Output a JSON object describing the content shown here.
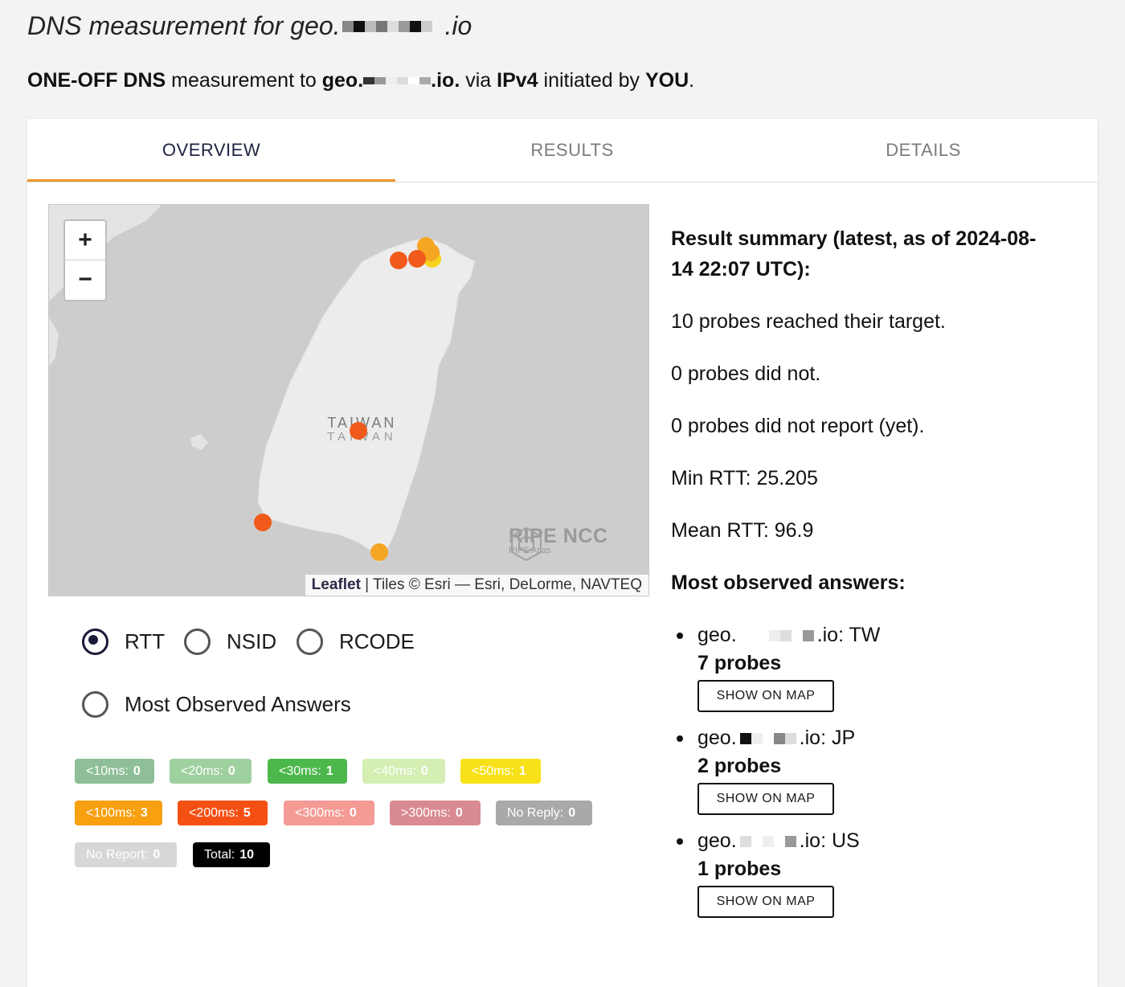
{
  "page": {
    "title_prefix": "DNS measurement for geo.",
    "title_suffix": ".io"
  },
  "subtitle": {
    "type": "ONE-OFF DNS",
    "text1": " measurement to ",
    "target_prefix": "geo.",
    "target_suffix": ".io.",
    "text2": " via ",
    "protocol": "IPv4",
    "text3": " initiated by ",
    "initiator": "YOU",
    "text4": "."
  },
  "tabs": [
    {
      "label": "OVERVIEW",
      "active": true
    },
    {
      "label": "RESULTS",
      "active": false
    },
    {
      "label": "DETAILS",
      "active": false
    }
  ],
  "map": {
    "zoom_in": "+",
    "zoom_out": "−",
    "country_label": "TAIWAN",
    "country_label_native": "TAIWAN",
    "logo_name": "RIPE NCC",
    "logo_sub": "RIPE Atlas",
    "attribution_link": "Leaflet",
    "attribution_text": " | Tiles © Esri — Esri, DeLorme, NAVTEQ"
  },
  "view_options": [
    {
      "label": "RTT",
      "checked": true
    },
    {
      "label": "NSID",
      "checked": false
    },
    {
      "label": "RCODE",
      "checked": false
    },
    {
      "label": "Most Observed Answers",
      "checked": false
    }
  ],
  "rtt_badges": [
    {
      "label": "<10ms:",
      "count": "0",
      "color": "#8fbf98"
    },
    {
      "label": "<20ms:",
      "count": "0",
      "color": "#9fd0a0"
    },
    {
      "label": "<30ms:",
      "count": "1",
      "color": "#4cb84c"
    },
    {
      "label": "<40ms:",
      "count": "0",
      "color": "#d4eeb4"
    },
    {
      "label": "<50ms:",
      "count": "1",
      "color": "#f7e21a"
    },
    {
      "label": "<100ms:",
      "count": "3",
      "color": "#f8a010"
    },
    {
      "label": "<200ms:",
      "count": "5",
      "color": "#f55014"
    },
    {
      "label": "<300ms:",
      "count": "0",
      "color": "#f49b95"
    },
    {
      "label": ">300ms:",
      "count": "0",
      "color": "#d98a92"
    },
    {
      "label": "No Reply:",
      "count": "0",
      "color": "#a9a9a9"
    },
    {
      "label": "No Report:",
      "count": "0",
      "color": "#d7d7d7"
    },
    {
      "label": "Total:",
      "count": "10",
      "color": "#000000"
    }
  ],
  "summary": {
    "heading": "Result summary (latest, as of 2024-08-14 22:07 UTC):",
    "reached": "10 probes reached their target.",
    "not_reached": "0 probes did not.",
    "not_reported": "0 probes did not report (yet).",
    "min_rtt": "Min RTT: 25.205",
    "mean_rtt": "Mean RTT: 96.9",
    "answers_heading": "Most observed answers:"
  },
  "answers": [
    {
      "prefix": "geo.",
      "suffix": ".io: TW",
      "probes": "7 probes",
      "button": "SHOW ON MAP"
    },
    {
      "prefix": "geo.",
      "suffix": ".io: JP",
      "probes": "2 probes",
      "button": "SHOW ON MAP"
    },
    {
      "prefix": "geo.",
      "suffix": ".io: US",
      "probes": "1 probes",
      "button": "SHOW ON MAP"
    }
  ],
  "colors": {
    "tab_active_underline": "#f0962a",
    "probe_red": "#f05a1a",
    "probe_orange": "#f5a623",
    "probe_yellow": "#f7d21a"
  }
}
